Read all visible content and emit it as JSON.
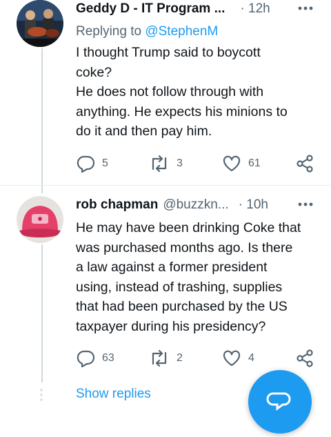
{
  "tweets": [
    {
      "author_name": "Geddy D - IT Program ...",
      "author_handle": "",
      "time": "· 12h",
      "replying_to_prefix": "Replying to",
      "replying_to_mention": "@StephenM",
      "text_lines": [
        "I thought Trump said to boycott",
        "coke?",
        "He does not follow through with",
        "anything. He expects his minions to",
        "do it and then pay him."
      ],
      "replies": "5",
      "retweets": "3",
      "likes": "61",
      "avatar_icon": "band-photo-avatar"
    },
    {
      "author_name": "rob chapman",
      "author_handle": "@buzzkn...",
      "time": "· 10h",
      "text_lines": [
        "He may have been drinking Coke that",
        "was purchased months ago. Is there",
        "a law against a former president",
        "using, instead of trashing, supplies",
        "that had been purchased by the US",
        "taxpayer during his presidency?"
      ],
      "replies": "63",
      "retweets": "2",
      "likes": "4",
      "avatar_icon": "pink-cap-avatar"
    }
  ],
  "show_replies_label": "Show replies",
  "icons": {
    "reply": "reply-icon",
    "retweet": "retweet-icon",
    "like": "heart-icon",
    "share": "share-icon",
    "more": "more-icon",
    "compose": "compose-fab-icon"
  },
  "colors": {
    "accent": "#1d9bf0",
    "muted": "#536471",
    "text": "#0f1419",
    "thread_line": "#cfd9de"
  }
}
